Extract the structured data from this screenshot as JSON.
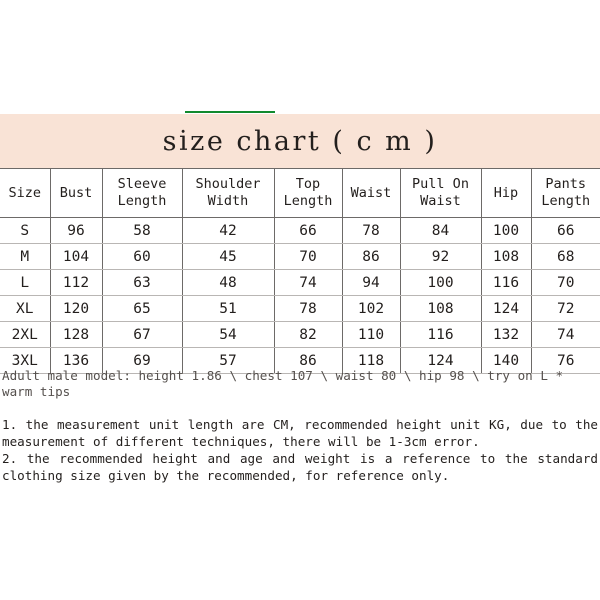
{
  "banner": {
    "title": "size chart ( c m )",
    "background_color": "#F9E3D6",
    "accent_rule_color": "#118A2E"
  },
  "table": {
    "headers": [
      {
        "line1": "Size",
        "line2": ""
      },
      {
        "line1": "Bust",
        "line2": ""
      },
      {
        "line1": "Sleeve",
        "line2": "Length"
      },
      {
        "line1": "Shoulder",
        "line2": "Width"
      },
      {
        "line1": "Top",
        "line2": "Length"
      },
      {
        "line1": "Waist",
        "line2": ""
      },
      {
        "line1": "Pull On",
        "line2": "Waist"
      },
      {
        "line1": "Hip",
        "line2": ""
      },
      {
        "line1": "Pants",
        "line2": "Length"
      }
    ],
    "rows": [
      {
        "size": "S",
        "bust": "96",
        "sleeve_length": "58",
        "shoulder_width": "42",
        "top_length": "66",
        "waist": "78",
        "pull_on_waist": "84",
        "hip": "100",
        "pants_length": "66"
      },
      {
        "size": "M",
        "bust": "104",
        "sleeve_length": "60",
        "shoulder_width": "45",
        "top_length": "70",
        "waist": "86",
        "pull_on_waist": "92",
        "hip": "108",
        "pants_length": "68"
      },
      {
        "size": "L",
        "bust": "112",
        "sleeve_length": "63",
        "shoulder_width": "48",
        "top_length": "74",
        "waist": "94",
        "pull_on_waist": "100",
        "hip": "116",
        "pants_length": "70"
      },
      {
        "size": "XL",
        "bust": "120",
        "sleeve_length": "65",
        "shoulder_width": "51",
        "top_length": "78",
        "waist": "102",
        "pull_on_waist": "108",
        "hip": "124",
        "pants_length": "72"
      },
      {
        "size": "2XL",
        "bust": "128",
        "sleeve_length": "67",
        "shoulder_width": "54",
        "top_length": "82",
        "waist": "110",
        "pull_on_waist": "116",
        "hip": "132",
        "pants_length": "74"
      },
      {
        "size": "3XL",
        "bust": "136",
        "sleeve_length": "69",
        "shoulder_width": "57",
        "top_length": "86",
        "waist": "118",
        "pull_on_waist": "124",
        "hip": "140",
        "pants_length": "76"
      }
    ]
  },
  "notes": {
    "model": "Adult male model: height 1.86 \\ chest 107 \\ waist 80 \\ hip 98 \\ try on L * warm tips",
    "note1": "1. the measurement unit length are CM, recommended height unit KG, due to the measurement of different techniques, there will be 1-3cm error.",
    "note2": "2. the recommended height and age and weight is a reference to the standard clothing size given by the recommended, for reference only."
  }
}
